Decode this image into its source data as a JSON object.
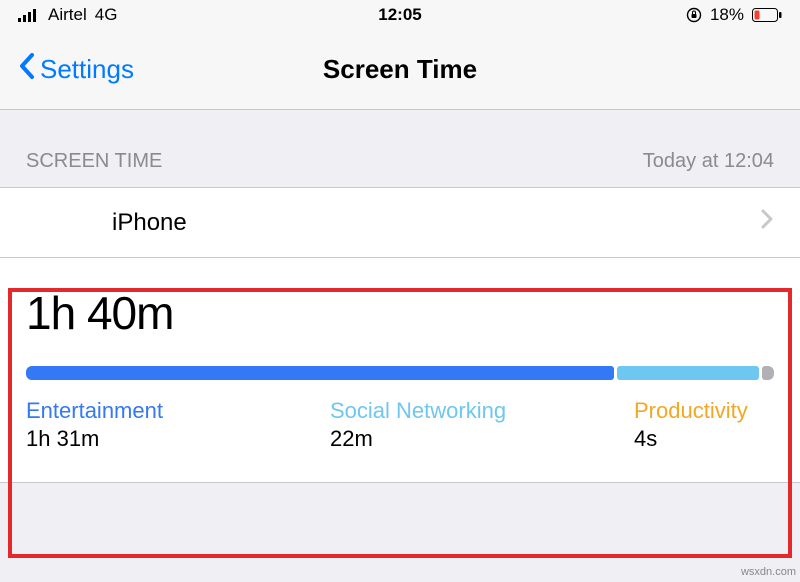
{
  "statusbar": {
    "carrier": "Airtel",
    "network": "4G",
    "time": "12:05",
    "battery_pct": "18%"
  },
  "nav": {
    "back_label": "Settings",
    "title": "Screen Time"
  },
  "section": {
    "header": "SCREEN TIME",
    "timestamp": "Today at 12:04"
  },
  "device_row": {
    "label": "iPhone"
  },
  "usage": {
    "total": "1h 40m",
    "categories": [
      {
        "name": "Entertainment",
        "value": "1h 31m"
      },
      {
        "name": "Social Networking",
        "value": "22m"
      },
      {
        "name": "Productivity",
        "value": "4s"
      }
    ]
  },
  "chart_data": {
    "type": "bar",
    "orientation": "horizontal-stacked",
    "title": "Screen Time",
    "total_label": "1h 40m",
    "series": [
      {
        "name": "Entertainment",
        "seconds": 5460,
        "color": "#3478f6"
      },
      {
        "name": "Social Networking",
        "seconds": 1320,
        "color": "#6ec7f0"
      },
      {
        "name": "Productivity",
        "seconds": 4,
        "color": "#b0b0b5"
      }
    ]
  },
  "watermark": "wsxdn.com"
}
